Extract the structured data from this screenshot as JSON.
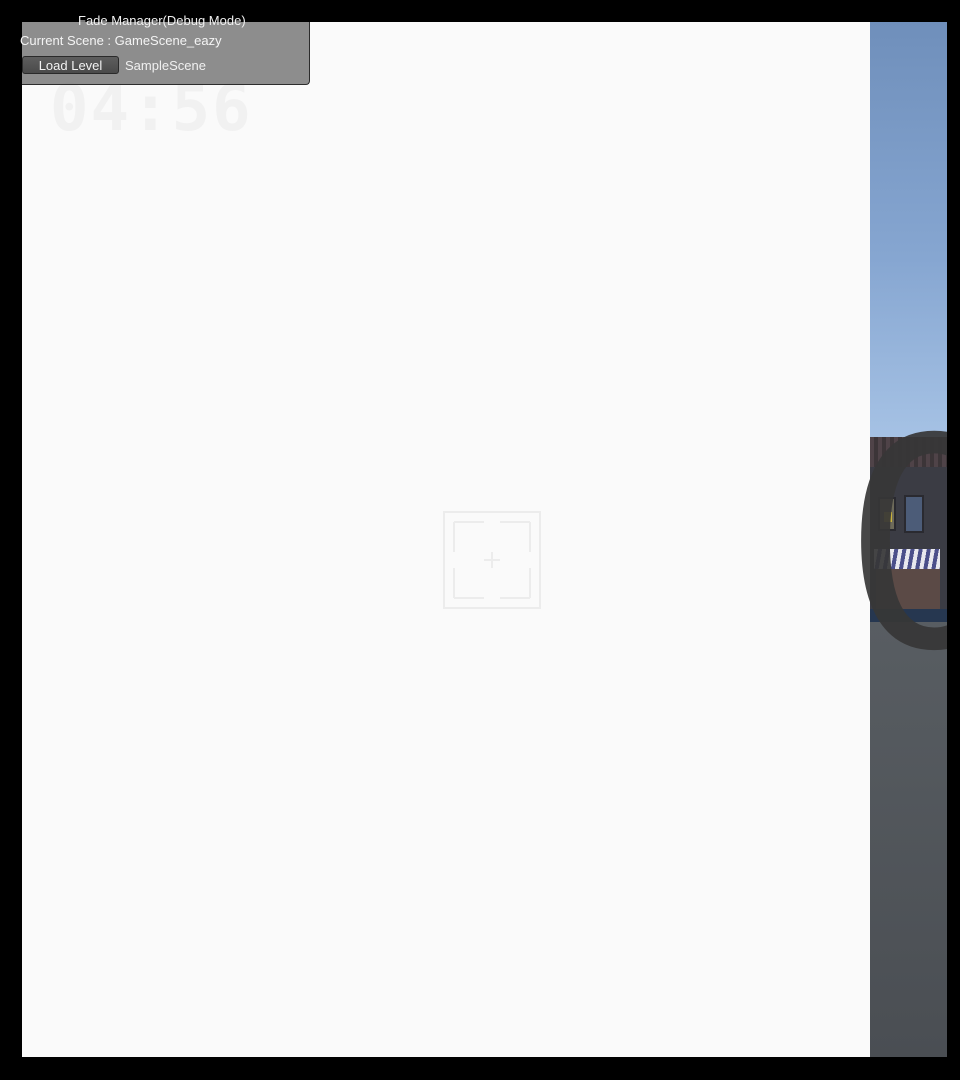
{
  "debug_panel": {
    "title": "Fade Manager(Debug Mode)",
    "current_scene": "Current Scene : GameScene_eazy",
    "load_button_label": "Load Level",
    "scene_input_value": "SampleScene"
  },
  "hud": {
    "timer": "04:56",
    "countdown_digit": "0"
  },
  "colors": {
    "fade_overlay": "#fafafa",
    "sky": "#86a6d1",
    "ground": "#4a4e53",
    "countdown": "#373737",
    "panel": "#6e6e6e"
  },
  "icons": {
    "reticle": "crosshair-icon"
  }
}
